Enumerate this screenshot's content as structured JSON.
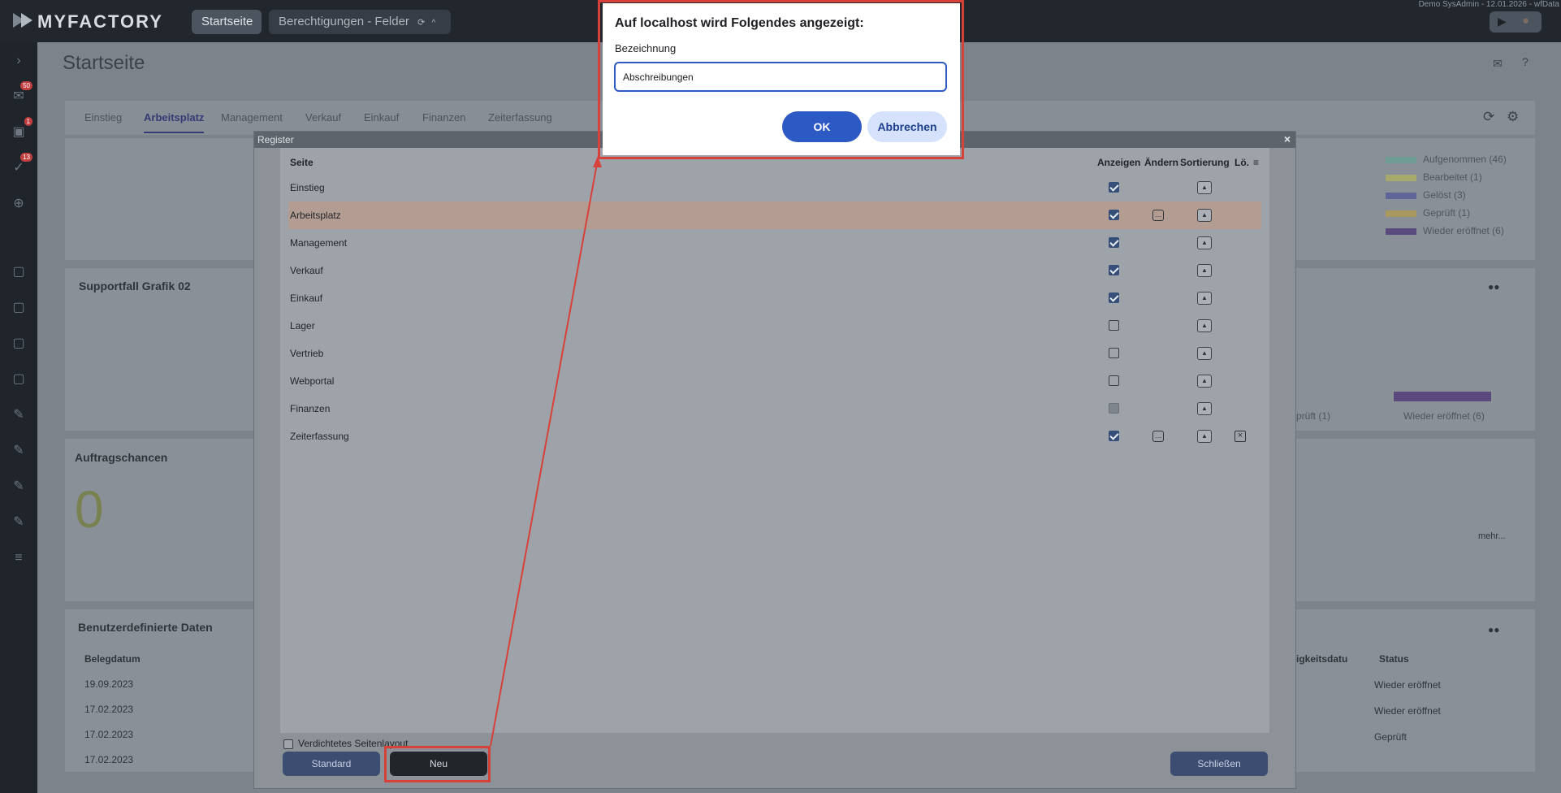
{
  "app": {
    "brand": "MYFACTORY",
    "user_info": "Demo SysAdmin - 12.01.2026 - wfData"
  },
  "tabs": [
    {
      "label": "Startseite"
    },
    {
      "label": "Berechtigungen - Felder"
    }
  ],
  "sidebar": {
    "badges": [
      "50",
      "1",
      "13"
    ]
  },
  "page": {
    "title": "Startseite"
  },
  "card_tabs": [
    "Einstieg",
    "Arbeitsplatz",
    "Management",
    "Verkauf",
    "Einkauf",
    "Finanzen",
    "Zeiterfassung"
  ],
  "cards": {
    "support_title": "Supportfall Grafik 02",
    "auftrag_title": "Auftragschancen",
    "auftrag_value": "0",
    "auftrag_more": "mehr...",
    "ud_title": "Benutzerdefinierte Daten",
    "ud_col": "Belegdatum",
    "ud_dates": [
      "19.09.2023",
      "17.02.2023",
      "17.02.2023",
      "17.02.2023"
    ],
    "ud_col2": "igkeitsdatu",
    "ud_col3": "Status",
    "ud_status": [
      "Wieder eröffnet",
      "Wieder eröffnet",
      "Geprüft"
    ],
    "legend": [
      "Aufgenommen (46)",
      "Bearbeitet (1)",
      "Gelöst (3)",
      "Geprüft (1)",
      "Wieder eröffnet (6)"
    ],
    "legend_colors": [
      "#6f9c95",
      "#a7a86c",
      "#5d6697",
      "#a8975e",
      "#5b4a7d"
    ],
    "axis_labels": [
      "prüft (1)",
      "Wieder eröffnet (6)"
    ]
  },
  "register": {
    "title": "Register",
    "columns": {
      "seite": "Seite",
      "anzeigen": "Anzeigen",
      "aendern": "Ändern",
      "sortierung": "Sortierung",
      "loeschen": "Lö."
    },
    "rows": [
      {
        "label": "Einstieg",
        "show": "on",
        "edit": false,
        "del": false
      },
      {
        "label": "Arbeitsplatz",
        "show": "on",
        "edit": true,
        "del": false,
        "selected": true
      },
      {
        "label": "Management",
        "show": "on",
        "edit": false,
        "del": false
      },
      {
        "label": "Verkauf",
        "show": "on",
        "edit": false,
        "del": false
      },
      {
        "label": "Einkauf",
        "show": "on",
        "edit": false,
        "del": false
      },
      {
        "label": "Lager",
        "show": "off",
        "edit": false,
        "del": false
      },
      {
        "label": "Vertrieb",
        "show": "off",
        "edit": false,
        "del": false
      },
      {
        "label": "Webportal",
        "show": "off",
        "edit": false,
        "del": false
      },
      {
        "label": "Finanzen",
        "show": "disabled",
        "edit": false,
        "del": false
      },
      {
        "label": "Zeiterfassung",
        "show": "on",
        "edit": true,
        "del": true
      }
    ],
    "dense_label": "Verdichtetes Seitenlayout",
    "btn_standard": "Standard",
    "btn_neu": "Neu",
    "btn_close": "Schließen"
  },
  "dialog": {
    "title": "Auf localhost wird Folgendes angezeigt:",
    "label": "Bezeichnung",
    "value": "Abschreibungen",
    "ok": "OK",
    "cancel": "Abbrechen"
  }
}
